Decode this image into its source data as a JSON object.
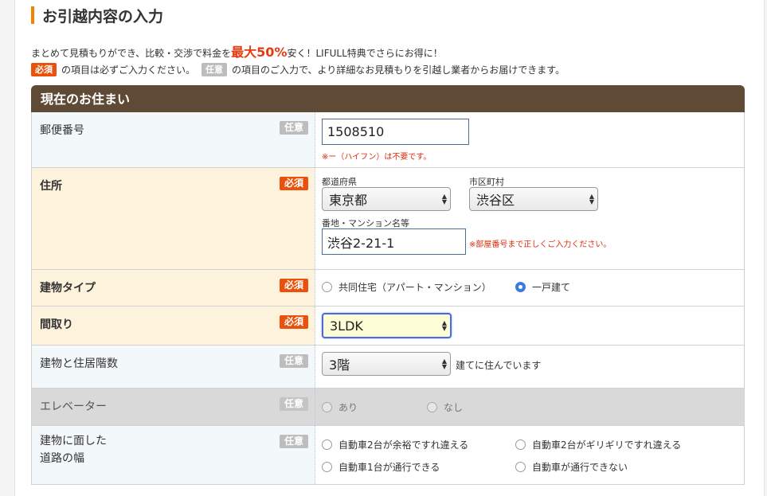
{
  "page_title": "お引越内容の入力",
  "intro": {
    "line1_pre": "まとめて見積もりができ、比較・交渉で料金を",
    "line1_highlight": "最大50%",
    "line1_post": "安く！LIFULL特典でさらにお得に！",
    "required_badge": "必須",
    "line2_mid": "の項目は必ずご入力ください。",
    "optional_badge": "任意",
    "line2_post": "の項目のご入力で、より詳細なお見積もりを引越し業者からお届けできます。"
  },
  "section_title": "現在のお住まい",
  "rows": {
    "postal": {
      "label": "郵便番号",
      "badge": "任意",
      "value": "1508510",
      "note": "※ー（ハイフン）は不要です。"
    },
    "address": {
      "label": "住所",
      "badge": "必須",
      "pref_label": "都道府県",
      "pref_value": "東京都",
      "city_label": "市区町村",
      "city_value": "渋谷区",
      "street_label": "番地・マンション名等",
      "street_value": "渋谷2-21-1",
      "street_note": "※部屋番号まで正しくご入力ください。"
    },
    "building_type": {
      "label": "建物タイプ",
      "badge": "必須",
      "options": [
        "共同住宅（アパート・マンション）",
        "一戸建て"
      ],
      "selected": "一戸建て"
    },
    "layout": {
      "label": "間取り",
      "badge": "必須",
      "value": "3LDK"
    },
    "floors": {
      "label": "建物と住居階数",
      "badge": "任意",
      "value": "3階",
      "suffix": "建てに住んでいます"
    },
    "elevator": {
      "label": "エレベーター",
      "badge": "任意",
      "options": [
        "あり",
        "なし"
      ]
    },
    "road": {
      "label_line1": "建物に面した",
      "label_line2": "道路の幅",
      "badge": "任意",
      "options": [
        "自動車2台が余裕ですれ違える",
        "自動車2台がギリギリですれ違える",
        "自動車1台が通行できる",
        "自動車が通行できない"
      ]
    }
  },
  "colors": {
    "accent_orange": "#f08300",
    "required_badge": "#e8520d",
    "optional_badge": "#bdbdbd",
    "section_header": "#5f4a35",
    "note_red": "#e02b0b",
    "radio_selected": "#3a7be3"
  },
  "icons": {
    "select_arrow": "up-down-chevron-icon",
    "radio": "radio-circle-icon"
  }
}
